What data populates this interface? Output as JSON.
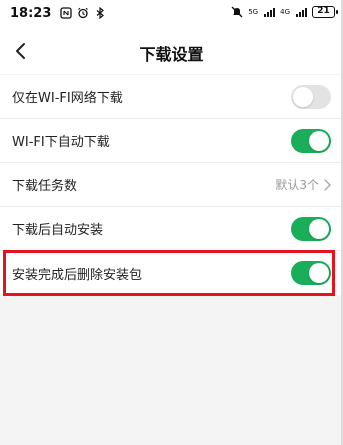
{
  "status_bar": {
    "time": "18:23",
    "network_labels": [
      "5G",
      "4G"
    ],
    "battery_level": "21"
  },
  "header": {
    "title": "下载设置"
  },
  "settings": [
    {
      "label": "仅在WI-FI网络下载",
      "control": "toggle",
      "state": "off"
    },
    {
      "label": "WI-FI下自动下载",
      "control": "toggle",
      "state": "on"
    },
    {
      "label": "下载任务数",
      "control": "value",
      "value": "默认3个"
    },
    {
      "label": "下载后自动安装",
      "control": "toggle",
      "state": "on"
    },
    {
      "label": "安装完成后删除安装包",
      "control": "toggle",
      "state": "on"
    }
  ],
  "colors": {
    "toggle_on": "#1aad5a",
    "toggle_off": "#e3e3e3",
    "highlight": "#e3141e"
  },
  "icons": {
    "back": "chevron-left-icon",
    "value_arrow": "chevron-right-icon"
  }
}
